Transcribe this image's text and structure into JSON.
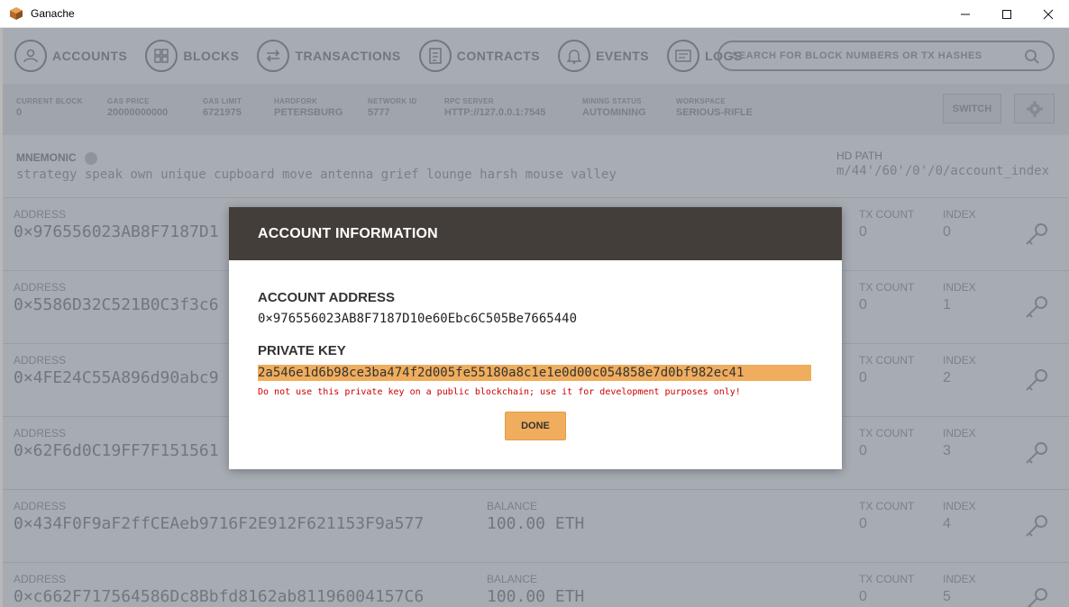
{
  "window": {
    "title": "Ganache",
    "minimize": "—",
    "maximize": "☐",
    "close": "✕"
  },
  "nav": {
    "items": [
      {
        "label": "ACCOUNTS",
        "icon": "user-icon"
      },
      {
        "label": "BLOCKS",
        "icon": "grid-icon"
      },
      {
        "label": "TRANSACTIONS",
        "icon": "arrows-icon"
      },
      {
        "label": "CONTRACTS",
        "icon": "document-icon"
      },
      {
        "label": "EVENTS",
        "icon": "bell-icon"
      },
      {
        "label": "LOGS",
        "icon": "terminal-icon"
      }
    ],
    "search_placeholder": "SEARCH FOR BLOCK NUMBERS OR TX HASHES"
  },
  "status": {
    "current_block": {
      "label": "CURRENT BLOCK",
      "value": "0"
    },
    "gas_price": {
      "label": "GAS PRICE",
      "value": "20000000000"
    },
    "gas_limit": {
      "label": "GAS LIMIT",
      "value": "6721975"
    },
    "hardfork": {
      "label": "HARDFORK",
      "value": "PETERSBURG"
    },
    "network_id": {
      "label": "NETWORK ID",
      "value": "5777"
    },
    "rpc_server": {
      "label": "RPC SERVER",
      "value": "HTTP://127.0.0.1:7545"
    },
    "mining_status": {
      "label": "MINING STATUS",
      "value": "AUTOMINING"
    },
    "workspace": {
      "label": "WORKSPACE",
      "value": "SERIOUS-RIFLE"
    },
    "switch_label": "SWITCH"
  },
  "mnemonic": {
    "label": "MNEMONIC",
    "words": "strategy speak own unique cupboard move antenna grief lounge harsh mouse valley",
    "hd_path_label": "HD PATH",
    "hd_path": "m/44'/60'/0'/0/account_index"
  },
  "accounts": {
    "address_label": "ADDRESS",
    "balance_label": "BALANCE",
    "tx_count_label": "TX COUNT",
    "index_label": "INDEX",
    "rows": [
      {
        "address": "0×976556023AB8F7187D1",
        "balance": "",
        "tx_count": "0",
        "index": "0"
      },
      {
        "address": "0×5586D32C521B0C3f3c6",
        "balance": "",
        "tx_count": "0",
        "index": "1"
      },
      {
        "address": "0×4FE24C55A896d90abc9",
        "balance": "",
        "tx_count": "0",
        "index": "2"
      },
      {
        "address": "0×62F6d0C19FF7F151561",
        "balance": "",
        "tx_count": "0",
        "index": "3"
      },
      {
        "address": "0×434F0F9aF2ffCEAeb9716F2E912F621153F9a577",
        "balance": "100.00 ETH",
        "tx_count": "0",
        "index": "4"
      },
      {
        "address": "0×c662F717564586Dc8Bbfd8162ab81196004157C6",
        "balance": "100.00 ETH",
        "tx_count": "0",
        "index": "5"
      }
    ]
  },
  "modal": {
    "title": "ACCOUNT INFORMATION",
    "address_label": "ACCOUNT ADDRESS",
    "address": "0×976556023AB8F7187D10e60Ebc6C505Be7665440",
    "private_key_label": "PRIVATE KEY",
    "private_key": "2a546e1d6b98ce3ba474f2d005fe55180a8c1e1e0d00c054858e7d0bf982ec41",
    "warning": "Do not use this private key on a public blockchain; use it for development purposes only!",
    "done_label": "DONE"
  },
  "colors": {
    "accent": "#f0ad5d",
    "modal_header": "#433e3a",
    "warning": "#cc0000"
  }
}
